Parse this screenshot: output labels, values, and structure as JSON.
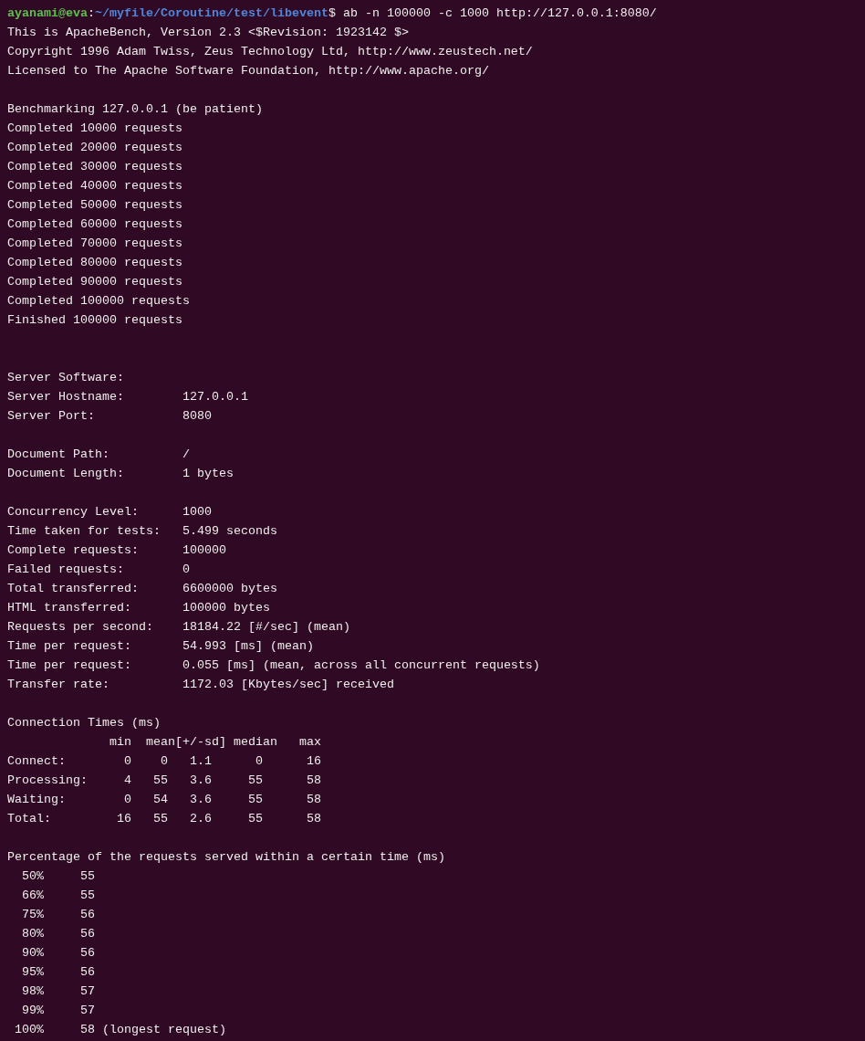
{
  "terminal": {
    "lines": [
      {
        "kind": "prompt",
        "user": "ayanami@eva",
        "separator": ":",
        "path": "~/myfile/Coroutine/test/libevent",
        "command": "$ ab -n 100000 -c 1000 http://127.0.0.1:8080/"
      },
      {
        "kind": "text",
        "text": "This is ApacheBench, Version 2.3 <$Revision: 1923142 $>"
      },
      {
        "kind": "text",
        "text": "Copyright 1996 Adam Twiss, Zeus Technology Ltd, http://www.zeustech.net/"
      },
      {
        "kind": "text",
        "text": "Licensed to The Apache Software Foundation, http://www.apache.org/"
      },
      {
        "kind": "blank"
      },
      {
        "kind": "text",
        "text": "Benchmarking 127.0.0.1 (be patient)"
      },
      {
        "kind": "text",
        "text": "Completed 10000 requests"
      },
      {
        "kind": "text",
        "text": "Completed 20000 requests"
      },
      {
        "kind": "text",
        "text": "Completed 30000 requests"
      },
      {
        "kind": "text",
        "text": "Completed 40000 requests"
      },
      {
        "kind": "text",
        "text": "Completed 50000 requests"
      },
      {
        "kind": "text",
        "text": "Completed 60000 requests"
      },
      {
        "kind": "text",
        "text": "Completed 70000 requests"
      },
      {
        "kind": "text",
        "text": "Completed 80000 requests"
      },
      {
        "kind": "text",
        "text": "Completed 90000 requests"
      },
      {
        "kind": "text",
        "text": "Completed 100000 requests"
      },
      {
        "kind": "text",
        "text": "Finished 100000 requests"
      },
      {
        "kind": "blank"
      },
      {
        "kind": "blank"
      },
      {
        "kind": "text",
        "text": "Server Software:"
      },
      {
        "kind": "text",
        "text": "Server Hostname:        127.0.0.1"
      },
      {
        "kind": "text",
        "text": "Server Port:            8080"
      },
      {
        "kind": "blank"
      },
      {
        "kind": "text",
        "text": "Document Path:          /"
      },
      {
        "kind": "text",
        "text": "Document Length:        1 bytes"
      },
      {
        "kind": "blank"
      },
      {
        "kind": "text",
        "text": "Concurrency Level:      1000"
      },
      {
        "kind": "text",
        "text": "Time taken for tests:   5.499 seconds"
      },
      {
        "kind": "text",
        "text": "Complete requests:      100000"
      },
      {
        "kind": "text",
        "text": "Failed requests:        0"
      },
      {
        "kind": "text",
        "text": "Total transferred:      6600000 bytes"
      },
      {
        "kind": "text",
        "text": "HTML transferred:       100000 bytes"
      },
      {
        "kind": "text",
        "text": "Requests per second:    18184.22 [#/sec] (mean)"
      },
      {
        "kind": "text",
        "text": "Time per request:       54.993 [ms] (mean)"
      },
      {
        "kind": "text",
        "text": "Time per request:       0.055 [ms] (mean, across all concurrent requests)"
      },
      {
        "kind": "text",
        "text": "Transfer rate:          1172.03 [Kbytes/sec] received"
      },
      {
        "kind": "blank"
      },
      {
        "kind": "text",
        "text": "Connection Times (ms)"
      },
      {
        "kind": "text",
        "text": "              min  mean[+/-sd] median   max"
      },
      {
        "kind": "text",
        "text": "Connect:        0    0   1.1      0      16"
      },
      {
        "kind": "text",
        "text": "Processing:     4   55   3.6     55      58"
      },
      {
        "kind": "text",
        "text": "Waiting:        0   54   3.6     55      58"
      },
      {
        "kind": "text",
        "text": "Total:         16   55   2.6     55      58"
      },
      {
        "kind": "blank"
      },
      {
        "kind": "text",
        "text": "Percentage of the requests served within a certain time (ms)"
      },
      {
        "kind": "text",
        "text": "  50%     55"
      },
      {
        "kind": "text",
        "text": "  66%     55"
      },
      {
        "kind": "text",
        "text": "  75%     56"
      },
      {
        "kind": "text",
        "text": "  80%     56"
      },
      {
        "kind": "text",
        "text": "  90%     56"
      },
      {
        "kind": "text",
        "text": "  95%     56"
      },
      {
        "kind": "text",
        "text": "  98%     57"
      },
      {
        "kind": "text",
        "text": "  99%     57"
      },
      {
        "kind": "text",
        "text": " 100%     58 (longest request)"
      }
    ]
  }
}
